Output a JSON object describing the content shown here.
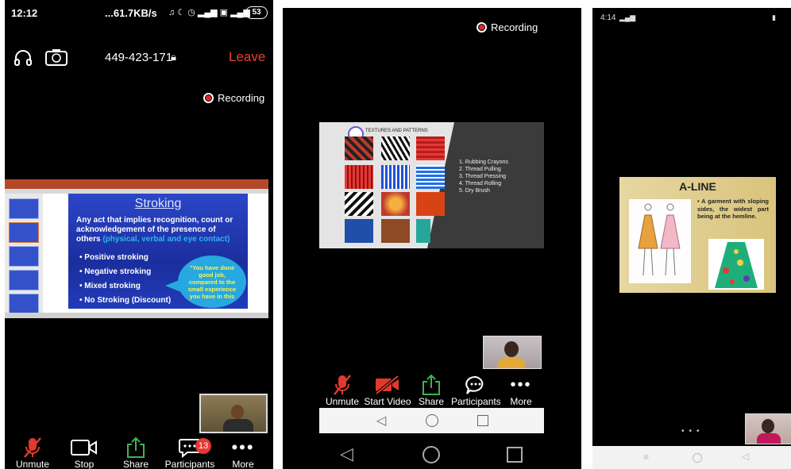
{
  "screen1": {
    "status": {
      "time": "12:12",
      "net": "...61.7KB/s",
      "battery": "53"
    },
    "meeting_id": "449-423-171",
    "leave": "Leave",
    "recording": "Recording",
    "slide": {
      "title": "Stroking",
      "intro": "Any act that implies recognition, count or acknowledgement of the presence of others",
      "intro_paren": "(physical, verbal and eye contact)",
      "bullets": [
        "Positive stroking",
        "Negative stroking",
        "Mixed stroking",
        "No Stroking (Discount)"
      ],
      "bubble": "\"You have done good job, compared to the small experience you have in this"
    },
    "toolbar": [
      {
        "label": "Unmute",
        "icon": "muted-mic-icon"
      },
      {
        "label": "Stop Video",
        "icon": "video-camera-icon"
      },
      {
        "label": "Share",
        "icon": "share-icon"
      },
      {
        "label": "Participants",
        "icon": "participants-icon",
        "badge": "13"
      },
      {
        "label": "More",
        "icon": "more-icon"
      }
    ]
  },
  "screen2": {
    "recording": "Recording",
    "slide": {
      "title": "TEXTURES AND PATTERNS",
      "items": [
        "1. Rubbing Crayons",
        "2. Thread Pulling",
        "3. Thread Pressing",
        "4. Thread Rolling",
        "5. Dry Brush"
      ]
    },
    "toolbar": [
      {
        "label": "Unmute",
        "icon": "muted-mic-icon"
      },
      {
        "label": "Start Video",
        "icon": "video-off-icon"
      },
      {
        "label": "Share",
        "icon": "share-icon"
      },
      {
        "label": "Participants",
        "icon": "participants-icon"
      },
      {
        "label": "More",
        "icon": "more-icon"
      }
    ]
  },
  "screen3": {
    "status": {
      "time": "4:14"
    },
    "slide": {
      "title": "A-LINE",
      "text": "A garment with sloping sides, the widest part being at the hemline."
    }
  },
  "colors": {
    "leave": "#e8412f",
    "record": "#e3262b",
    "mic_off": "#e03a2f",
    "share": "#3fb34f",
    "badge": "#e53935"
  }
}
